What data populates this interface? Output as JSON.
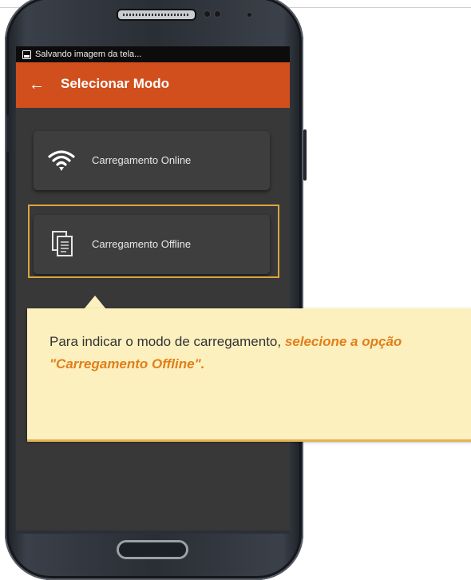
{
  "statusbar": {
    "text": "Salvando imagem da tela..."
  },
  "appbar": {
    "back_icon": "arrow-left-icon",
    "title": "Selecionar Modo"
  },
  "options": [
    {
      "icon": "wifi-icon",
      "label": "Carregamento Online"
    },
    {
      "icon": "document-copy-icon",
      "label": "Carregamento Offline"
    }
  ],
  "tooltip": {
    "text": "Para indicar o modo de carregamento, ",
    "emphasis": "selecione a opção \"Carregamento Offline\"."
  },
  "colors": {
    "appbar": "#d14f1d",
    "screen_bg": "#383838",
    "highlight_border": "#d9a441",
    "tooltip_bg": "#fdf0bf",
    "tooltip_emphasis": "#e07f1b"
  }
}
